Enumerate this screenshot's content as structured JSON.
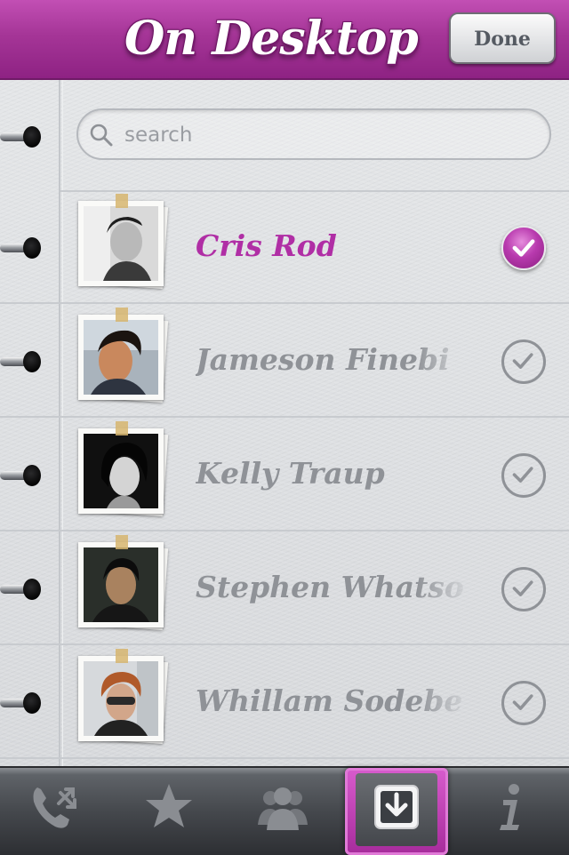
{
  "header": {
    "title": "On Desktop",
    "done_label": "Done"
  },
  "search": {
    "placeholder": "search",
    "value": ""
  },
  "contacts": [
    {
      "name": "Cris Rod",
      "selected": true
    },
    {
      "name": "Jameson Finebi",
      "selected": false
    },
    {
      "name": "Kelly Traup",
      "selected": false
    },
    {
      "name": "Stephen Whatso",
      "selected": false
    },
    {
      "name": "Whillam Sodebe",
      "selected": false
    }
  ],
  "tabs": [
    {
      "icon": "phone-transfer-icon",
      "active": false
    },
    {
      "icon": "star-icon",
      "active": false
    },
    {
      "icon": "group-icon",
      "active": false
    },
    {
      "icon": "download-icon",
      "active": true
    },
    {
      "icon": "info-icon",
      "active": false
    }
  ],
  "colors": {
    "accent": "#b02ea5",
    "header": "#a53597",
    "inactive_text": "#8f9297"
  }
}
